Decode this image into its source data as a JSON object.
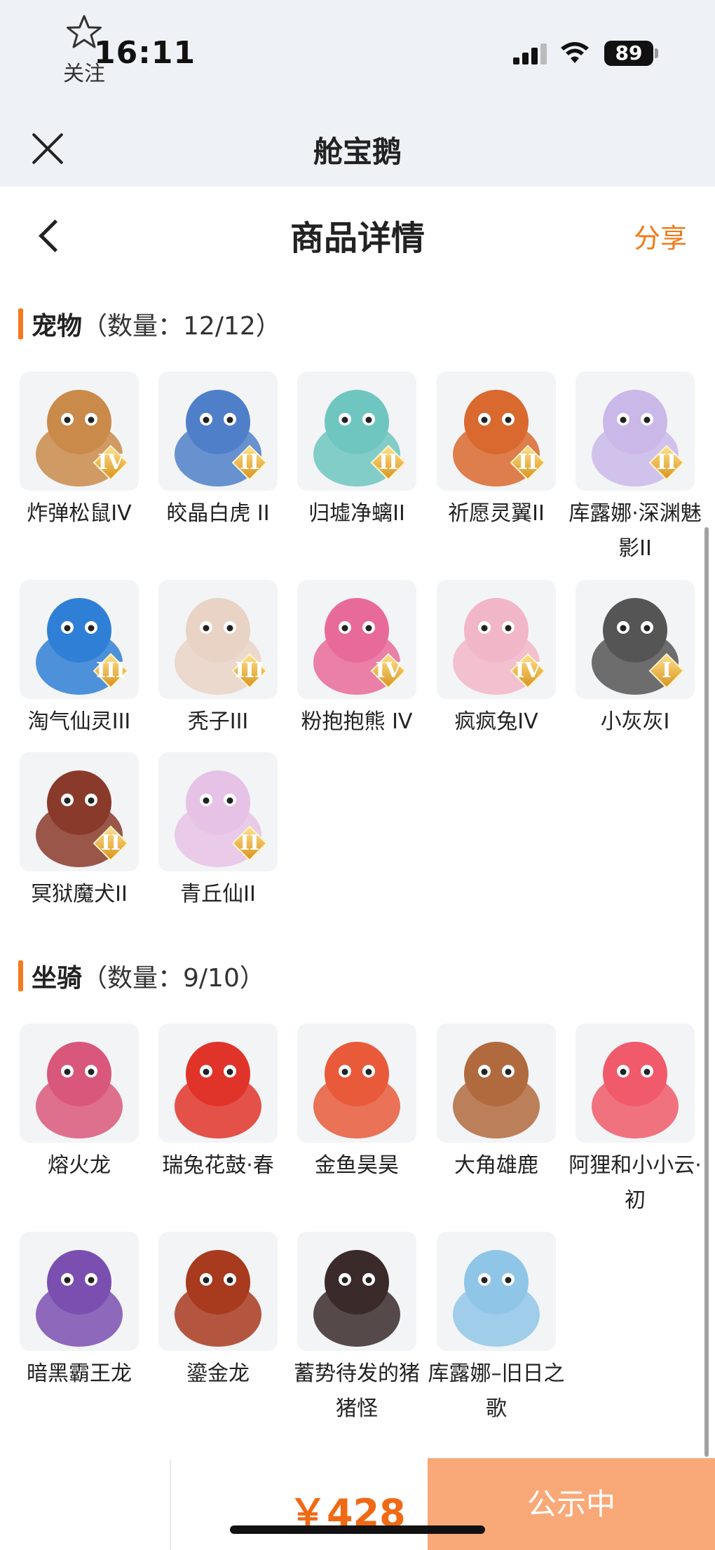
{
  "status_bar": {
    "time": "16:11",
    "battery": "89"
  },
  "mini_program": {
    "title": "舱宝鹅"
  },
  "header": {
    "title": "商品详情",
    "share_label": "分享"
  },
  "pets_section": {
    "name": "宠物",
    "count": "（数量：12/12）",
    "items": [
      {
        "label": "炸弹松鼠IV",
        "rank": "IV",
        "color": "#c98a4a"
      },
      {
        "label": "皎晶白虎 II",
        "rank": "II",
        "color": "#4f7fc9"
      },
      {
        "label": "归墟净螭II",
        "rank": "II",
        "color": "#6fc6c0"
      },
      {
        "label": "祈愿灵翼II",
        "rank": "II",
        "color": "#d9692e"
      },
      {
        "label": "库露娜·深渊魅影II",
        "rank": "II",
        "color": "#c9b8e8"
      },
      {
        "label": "淘气仙灵III",
        "rank": "III",
        "color": "#2f7fd6"
      },
      {
        "label": "秃子III",
        "rank": "III",
        "color": "#e8d3c4"
      },
      {
        "label": "粉抱抱熊 IV",
        "rank": "IV",
        "color": "#e86a9a"
      },
      {
        "label": "疯疯兔IV",
        "rank": "IV",
        "color": "#f2b6c9"
      },
      {
        "label": "小灰灰I",
        "rank": "I",
        "color": "#555555"
      },
      {
        "label": "冥狱魔犬II",
        "rank": "II",
        "color": "#8a3a2a"
      },
      {
        "label": "青丘仙II",
        "rank": "II",
        "color": "#e6c2e6"
      }
    ]
  },
  "mounts_section": {
    "name": "坐骑",
    "count": "（数量：9/10）",
    "items": [
      {
        "label": "熔火龙",
        "color": "#d9577a"
      },
      {
        "label": "瑞兔花鼓·春",
        "color": "#e0342a"
      },
      {
        "label": "金鱼昊昊",
        "color": "#e85a3a"
      },
      {
        "label": "大角雄鹿",
        "color": "#b06a3e"
      },
      {
        "label": "阿狸和小小云·初",
        "color": "#f05a6a"
      },
      {
        "label": "暗黑霸王龙",
        "color": "#7a4fb0"
      },
      {
        "label": "鎏金龙",
        "color": "#a83a1e"
      },
      {
        "label": "蓄势待发的猪猪怪",
        "color": "#3a2a2a"
      },
      {
        "label": "库露娜–旧日之歌",
        "color": "#8fc6e8"
      }
    ]
  },
  "bottom_bar": {
    "follow_label": "关注",
    "price": "￥428",
    "status_label": "公示中"
  },
  "colors": {
    "accent": "#f47a20",
    "price": "#f06a16",
    "status_button": "#f9a877"
  }
}
